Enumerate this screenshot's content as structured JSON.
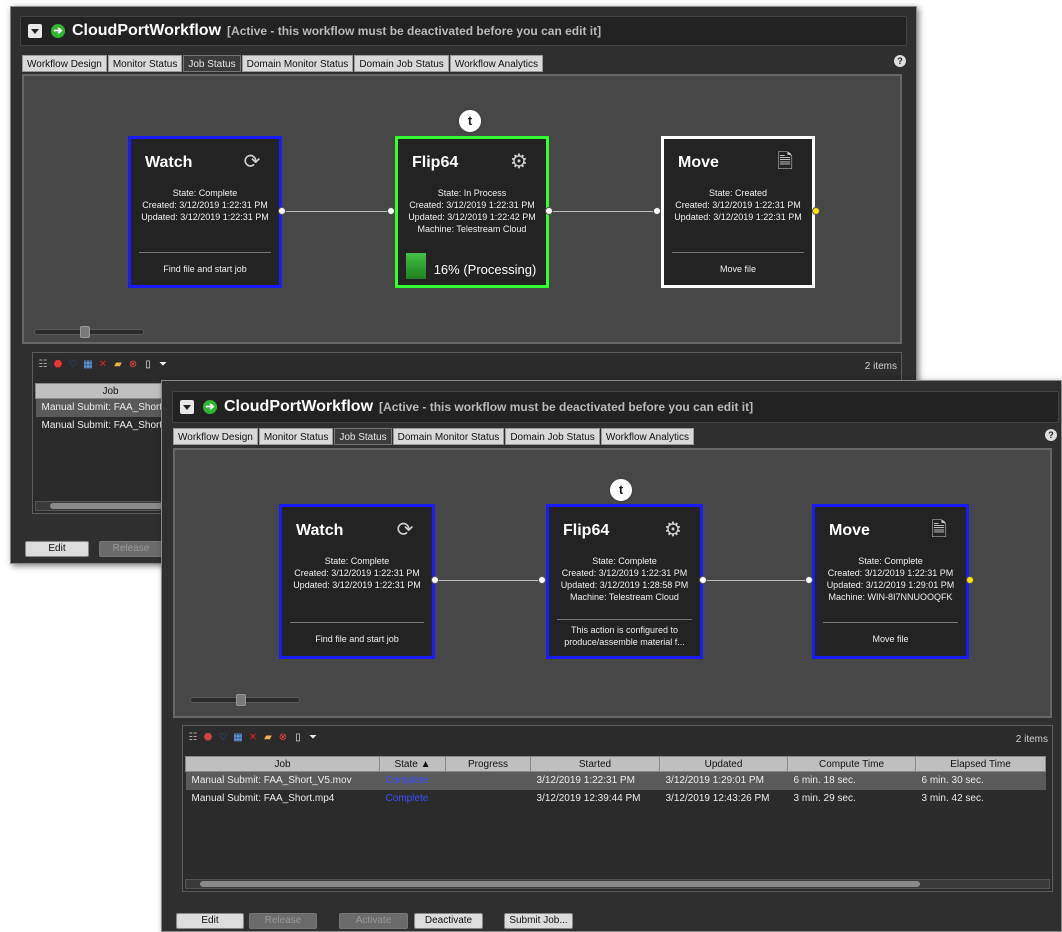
{
  "back_window": {
    "title": "CloudPortWorkflow",
    "status": "[Active - this workflow must be deactivated before you can edit it]",
    "tabs": [
      "Workflow Design",
      "Monitor Status",
      "Job Status",
      "Domain Monitor Status",
      "Domain Job Status",
      "Workflow Analytics"
    ],
    "active_tab": "Job Status",
    "help": "?",
    "timer_icon": "t",
    "nodes": [
      {
        "name": "Watch",
        "icon": "watch-icon",
        "lines": [
          "State: Complete",
          "Created: 3/12/2019 1:22:31 PM",
          "Updated: 3/12/2019 1:22:31 PM"
        ],
        "footer": "Find file and start job",
        "border": "#1a1aff"
      },
      {
        "name": "Flip64",
        "icon": "gears-icon",
        "lines": [
          "State: In Process",
          "Created: 3/12/2019 1:22:31 PM",
          "Updated: 3/12/2019 1:22:42 PM",
          "Machine: Telestream Cloud"
        ],
        "progress_text": "16% (Processing)",
        "progress": 0.16,
        "border": "#33ff33"
      },
      {
        "name": "Move",
        "icon": "move-file-icon",
        "lines": [
          "State: Created",
          "Created: 3/12/2019 1:22:31 PM",
          "Updated: 3/12/2019 1:22:31 PM"
        ],
        "footer": "Move file",
        "border": "#ffffff"
      }
    ],
    "count": "2 items",
    "table": {
      "header": "Job",
      "rows": [
        "Manual Submit: FAA_Short",
        "Manual Submit: FAA_Short"
      ]
    },
    "buttons": {
      "edit": "Edit",
      "release": "Release"
    }
  },
  "front_window": {
    "title": "CloudPortWorkflow",
    "status": "[Active - this workflow must be deactivated before you can edit it]",
    "tabs": [
      "Workflow Design",
      "Monitor Status",
      "Job Status",
      "Domain Monitor Status",
      "Domain Job Status",
      "Workflow Analytics"
    ],
    "active_tab": "Job Status",
    "help": "?",
    "timer_icon": "t",
    "nodes": [
      {
        "name": "Watch",
        "icon": "watch-icon",
        "lines": [
          "State: Complete",
          "Created: 3/12/2019 1:22:31 PM",
          "Updated: 3/12/2019 1:22:31 PM"
        ],
        "footer": "Find file and start job",
        "border": "#1a1aff"
      },
      {
        "name": "Flip64",
        "icon": "gears-icon",
        "lines": [
          "State: Complete",
          "Created: 3/12/2019 1:22:31 PM",
          "Updated: 3/12/2019 1:28:58 PM",
          "Machine: Telestream Cloud"
        ],
        "footer_lines": [
          "This action is configured to",
          "produce/assemble material f..."
        ],
        "border": "#1a1aff"
      },
      {
        "name": "Move",
        "icon": "move-file-icon",
        "lines": [
          "State: Complete",
          "Created: 3/12/2019 1:22:31 PM",
          "Updated: 3/12/2019 1:29:01 PM",
          "Machine: WIN-8I7NNUOOQFK"
        ],
        "footer": "Move file",
        "border": "#1a1aff"
      }
    ],
    "count": "2 items",
    "table": {
      "headers": [
        "Job",
        "State ▲",
        "Progress",
        "Started",
        "Updated",
        "Compute Time",
        "Elapsed Time"
      ],
      "rows": [
        [
          "Manual Submit: FAA_Short_V5.mov",
          "Complete",
          "",
          "3/12/2019 1:22:31 PM",
          "3/12/2019 1:29:01 PM",
          "6 min. 18 sec.",
          "6 min. 30 sec."
        ],
        [
          "Manual Submit: FAA_Short.mp4",
          "Complete",
          "",
          "3/12/2019 12:39:44 PM",
          "3/12/2019 12:43:26 PM",
          "3 min. 29 sec.",
          "3 min. 42 sec."
        ]
      ]
    },
    "buttons": {
      "edit": "Edit",
      "release": "Release",
      "activate": "Activate",
      "deactivate": "Deactivate",
      "submit": "Submit Job..."
    }
  },
  "colors": {
    "state_complete": "#3a4dff",
    "active_border_blue": "#1a1aff",
    "processing_green": "#33ff33"
  }
}
